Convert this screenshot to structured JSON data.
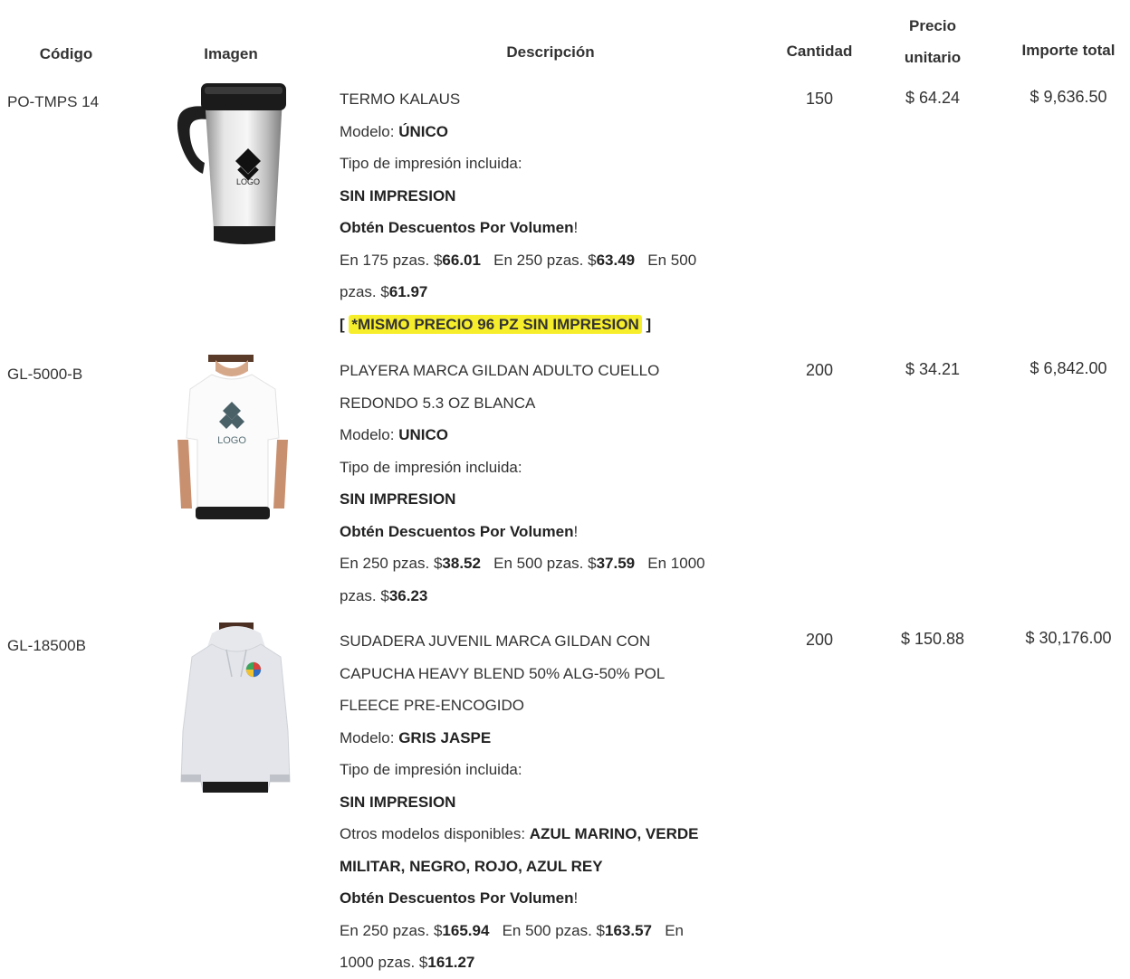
{
  "headers": {
    "codigo": "Código",
    "imagen": "Imagen",
    "descripcion": "Descripción",
    "cantidad": "Cantidad",
    "precio_l1": "Precio",
    "precio_l2": "unitario",
    "importe": "Importe total"
  },
  "colors": {
    "highlight": "#f7ee2b",
    "text": "#333333"
  },
  "items": [
    {
      "code": "PO-TMPS 14",
      "image_icon": "travel-mug-image",
      "logo_text": "LOGO",
      "name_l1": "TERMO KALAUS",
      "modelo_label": "Modelo: ",
      "modelo": "ÚNICO",
      "tipo_label": "Tipo de impresión incluida:",
      "tipo": "SIN IMPRESION",
      "promo_label": "Obtén Descuentos Por Volumen",
      "promo_suffix": "!",
      "t1": "En 175 pzas. $",
      "v1": "66.01",
      "t2": "En 250 pzas. $",
      "v2": "63.49",
      "t3": "En 500",
      "t4": "pzas. $",
      "v4": "61.97",
      "note_open": "[ ",
      "note": "*MISMO PRECIO 96 PZ SIN IMPRESION",
      "note_close": " ]",
      "qty": "150",
      "unit": "$ 64.24",
      "total": "$ 9,636.50"
    },
    {
      "code": "GL-5000-B",
      "image_icon": "white-tshirt-image",
      "logo_text": "LOGO",
      "name_l1": "PLAYERA MARCA GILDAN ADULTO CUELLO",
      "name_l2": "REDONDO 5.3 OZ BLANCA",
      "modelo_label": "Modelo: ",
      "modelo": "UNICO",
      "tipo_label": "Tipo de impresión incluida:",
      "tipo": "SIN IMPRESION",
      "promo_label": "Obtén Descuentos Por Volumen",
      "promo_suffix": "!",
      "t1": "En 250 pzas. $",
      "v1": "38.52",
      "t2": "En 500 pzas. $",
      "v2": "37.59",
      "t3": "En 1000",
      "t4": "pzas. $",
      "v4": "36.23",
      "qty": "200",
      "unit": "$ 34.21",
      "total": "$ 6,842.00"
    },
    {
      "code": "GL-18500B",
      "image_icon": "gray-hoodie-image",
      "name_l1": "SUDADERA JUVENIL MARCA GILDAN CON",
      "name_l2": "CAPUCHA HEAVY BLEND 50% ALG-50% POL",
      "name_l3": "FLEECE PRE-ENCOGIDO",
      "modelo_label": "Modelo: ",
      "modelo": "GRIS JASPE",
      "tipo_label": "Tipo de impresión incluida:",
      "tipo": "SIN IMPRESION",
      "otros_label": "Otros modelos disponibles: ",
      "otros_a": "AZUL MARINO, VERDE",
      "otros_b": "MILITAR, NEGRO, ROJO, AZUL REY",
      "promo_label": "Obtén Descuentos Por Volumen",
      "promo_suffix": "!",
      "t1": "En 250 pzas. $",
      "v1": "165.94",
      "t2": "En 500 pzas. $",
      "v2": "163.57",
      "t3": "En",
      "t4": "1000 pzas. $",
      "v4": "161.27",
      "qty": "200",
      "unit": "$ 150.88",
      "total": "$ 30,176.00"
    }
  ]
}
